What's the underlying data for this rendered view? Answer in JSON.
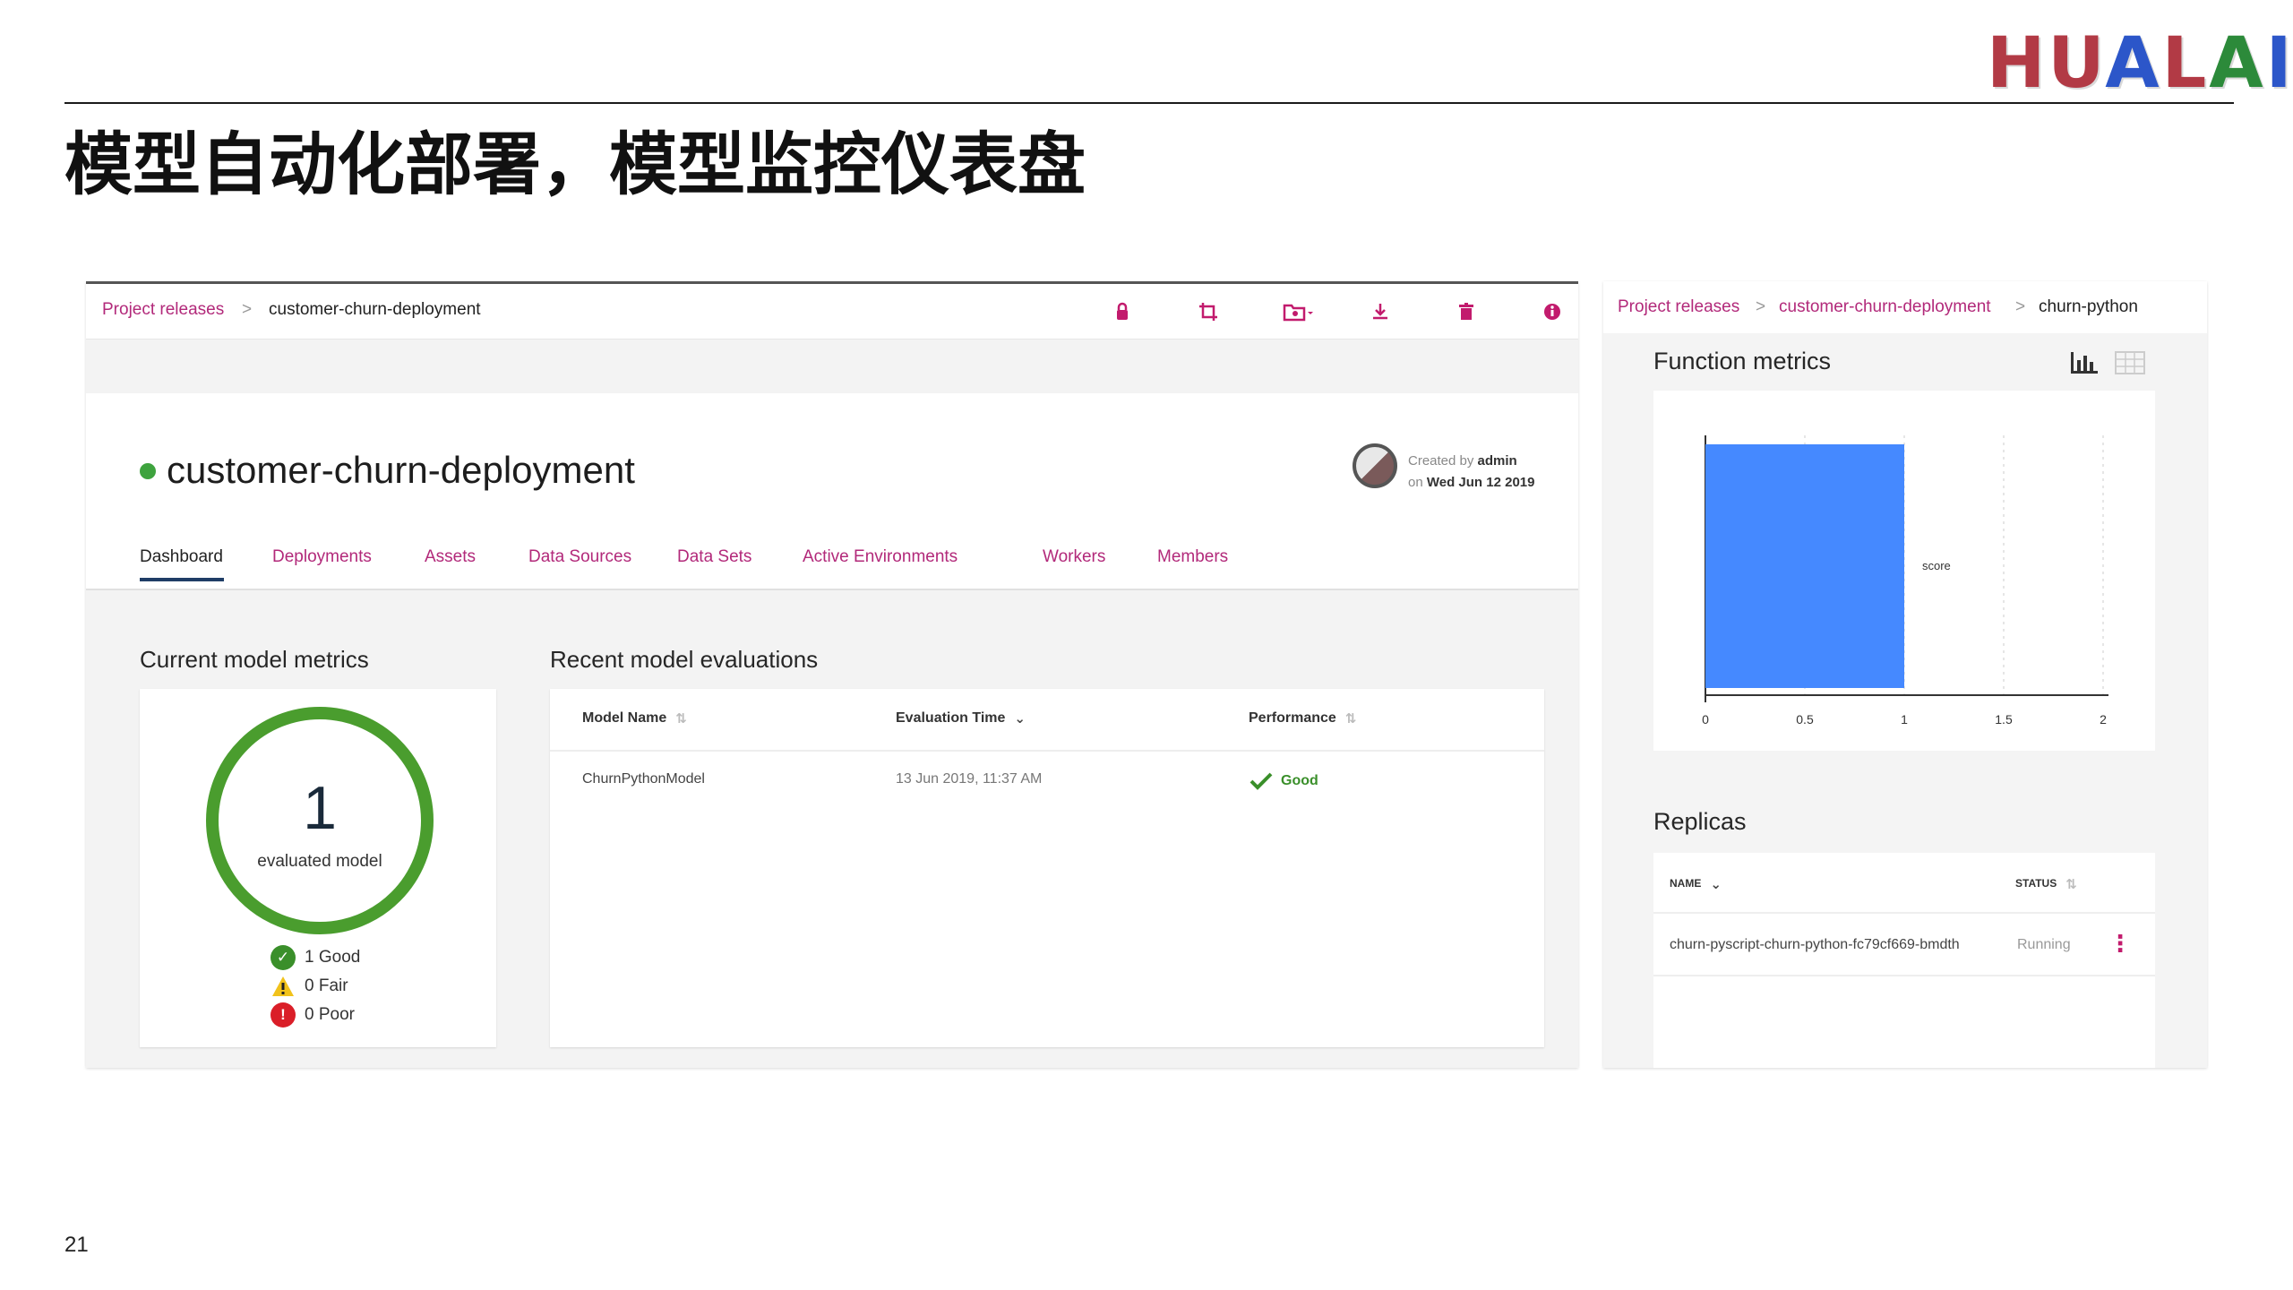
{
  "slide": {
    "logo": [
      "H",
      "U",
      "A",
      "L",
      "A",
      "I"
    ],
    "logo_colors": [
      "#b23a45",
      "#b23a45",
      "#2c56c9",
      "#b23a45",
      "#2c8a3a",
      "#2c56c9"
    ],
    "title": "模型自动化部署，模型监控仪表盘",
    "page_number": "21"
  },
  "left": {
    "breadcrumb": {
      "link": "Project releases",
      "sep": ">",
      "current": "customer-churn-deployment"
    },
    "toolbar_icons": [
      "lock-icon",
      "crop-icon",
      "folder-settings-icon",
      "download-icon",
      "trash-icon",
      "info-icon"
    ],
    "toolbar_color": "#c21b6d",
    "deployment": {
      "name": "customer-churn-deployment",
      "status_color": "#3ea33e",
      "created_by_label": "Created by",
      "created_by": "admin",
      "created_on_label": "on",
      "created_on": "Wed Jun 12 2019"
    },
    "tabs": [
      {
        "label": "Dashboard",
        "active": true
      },
      {
        "label": "Deployments",
        "active": false
      },
      {
        "label": "Assets",
        "active": false
      },
      {
        "label": "Data Sources",
        "active": false
      },
      {
        "label": "Data Sets",
        "active": false
      },
      {
        "label": "Active Environments",
        "active": false
      },
      {
        "label": "Workers",
        "active": false
      },
      {
        "label": "Members",
        "active": false
      }
    ],
    "metrics": {
      "title": "Current model metrics",
      "count": "1",
      "count_label": "evaluated model",
      "legend": [
        {
          "label": "1 Good",
          "icon": "check-circle-icon",
          "color": "#3a8f2a"
        },
        {
          "label": "0 Fair",
          "icon": "warning-icon",
          "color": "#f1c21b"
        },
        {
          "label": "0 Poor",
          "icon": "error-icon",
          "color": "#da1e28"
        }
      ]
    },
    "evaluations": {
      "title": "Recent model evaluations",
      "columns": [
        "Model Name",
        "Evaluation Time",
        "Performance"
      ],
      "rows": [
        {
          "model": "ChurnPythonModel",
          "time": "13 Jun 2019, 11:37 AM",
          "performance": "Good"
        }
      ]
    }
  },
  "right": {
    "breadcrumb": {
      "link1": "Project releases",
      "link2": "customer-churn-deployment",
      "current": "churn-python",
      "sep": ">"
    },
    "function_metrics_title": "Function metrics",
    "chart_data": {
      "type": "bar",
      "orientation": "horizontal",
      "categories": [
        "score"
      ],
      "values": [
        1
      ],
      "xlim": [
        0,
        2
      ],
      "xticks": [
        "0",
        "0.5",
        "1",
        "1.5",
        "2"
      ],
      "bar_color": "#4589ff",
      "grid": "vertical dashed"
    },
    "replicas": {
      "title": "Replicas",
      "columns": [
        "NAME",
        "STATUS"
      ],
      "rows": [
        {
          "name": "churn-pyscript-churn-python-fc79cf669-bmdth",
          "status": "Running"
        }
      ]
    }
  }
}
